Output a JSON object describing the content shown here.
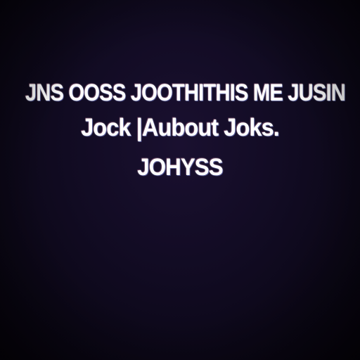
{
  "lines": [
    "JNS OOSS JOOTHITHIS ME JUSIN",
    "Jock |Aubout Joks.",
    "JOHYSS"
  ]
}
